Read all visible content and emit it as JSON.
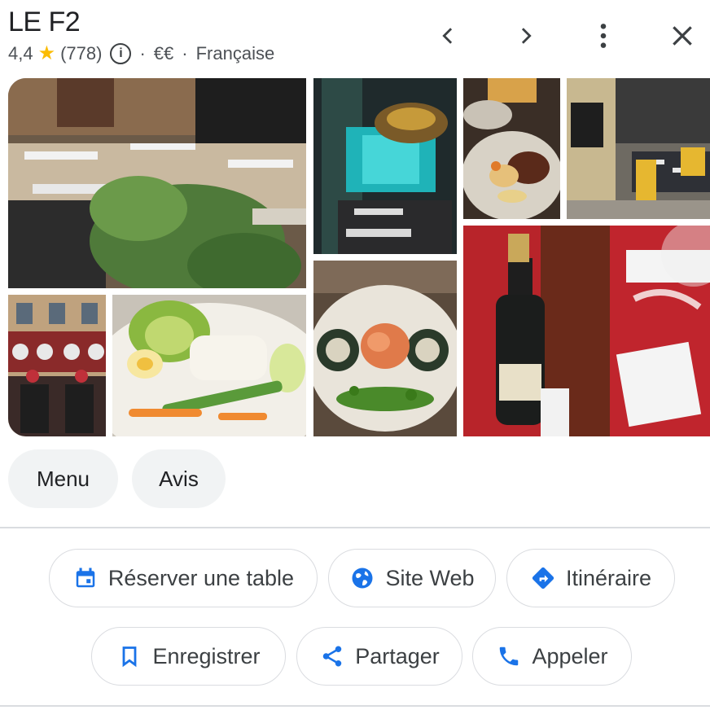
{
  "place": {
    "name": "LE F2",
    "rating": "4,4",
    "reviews": "(778)",
    "price": "€€",
    "category": "Française",
    "separator": "·"
  },
  "header_icons": {
    "prev": "chevron-left-icon",
    "next": "chevron-right-icon",
    "more": "more-vertical-icon",
    "close": "close-icon",
    "info": "info-icon",
    "star": "star-icon"
  },
  "photos": [
    {
      "name": "photo-terrace",
      "subject": "outdoor terrace with tables"
    },
    {
      "name": "photo-interior-teal",
      "subject": "teal-lit dining room"
    },
    {
      "name": "photo-plated-dish",
      "subject": "plated dish with meat"
    },
    {
      "name": "photo-street-terrace",
      "subject": "street terrace yellow chairs"
    },
    {
      "name": "photo-facade-flowers",
      "subject": "building facade with flowers"
    },
    {
      "name": "photo-fish-vegetables",
      "subject": "fish with vegetables"
    },
    {
      "name": "photo-maki-plate",
      "subject": "maki rolls on plate"
    },
    {
      "name": "photo-red-decor",
      "subject": "champagne and red decor"
    }
  ],
  "tabs": {
    "menu": "Menu",
    "reviews": "Avis"
  },
  "actions": {
    "reserve": "Réserver une table",
    "website": "Site Web",
    "directions": "Itinéraire",
    "save": "Enregistrer",
    "share": "Partager",
    "call": "Appeler"
  },
  "colors": {
    "accent_blue": "#1a73e8",
    "star_yellow": "#fbbc04",
    "chip_bg": "#f1f3f4",
    "border": "#dadce0"
  }
}
